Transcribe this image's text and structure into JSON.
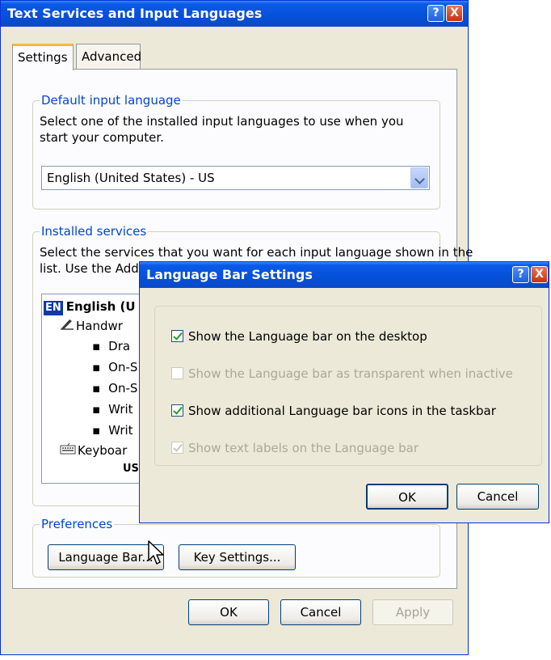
{
  "main_dialog": {
    "title": "Text Services and Input Languages",
    "tabs": [
      {
        "label": "Settings",
        "active": true
      },
      {
        "label": "Advanced",
        "active": false
      }
    ],
    "default_input": {
      "group_title": "Default input language",
      "description": "Select one of the installed input languages to use when you start your computer.",
      "selected": "English (United States) - US"
    },
    "installed_services": {
      "group_title": "Installed services",
      "description_line1": "Select the services that you want for each input language shown in the",
      "description_line2": "list. Use the Add a",
      "language_code": "EN",
      "language_name": "English (U",
      "handwriting": "Handwr",
      "bullets": [
        "Dra",
        "On-S",
        "On-S",
        "Writ",
        "Writ"
      ],
      "keyboard": "Keyboar",
      "us": "US"
    },
    "preferences": {
      "group_title": "Preferences",
      "language_bar_button": "Language Bar...",
      "key_settings_button": "Key Settings..."
    },
    "buttons": {
      "ok": "OK",
      "cancel": "Cancel",
      "apply": "Apply"
    }
  },
  "language_bar_dialog": {
    "title": "Language Bar Settings",
    "options": [
      {
        "label": "Show the Language bar on the desktop",
        "checked": true,
        "enabled": true
      },
      {
        "label": "Show the Language bar as transparent when inactive",
        "checked": false,
        "enabled": false
      },
      {
        "label": "Show additional Language bar icons in the taskbar",
        "checked": true,
        "enabled": true
      },
      {
        "label": "Show text labels on the Language bar",
        "checked": true,
        "enabled": false
      }
    ],
    "ok": "OK",
    "cancel": "Cancel"
  },
  "colors": {
    "title_bar": "#0550d8",
    "dialog_bg": "#ece9d8",
    "group_title": "#0046d5",
    "active_tab_accent": "#f5b83f"
  },
  "icons": {
    "help": "?",
    "close": "X",
    "bullet": "▪"
  }
}
